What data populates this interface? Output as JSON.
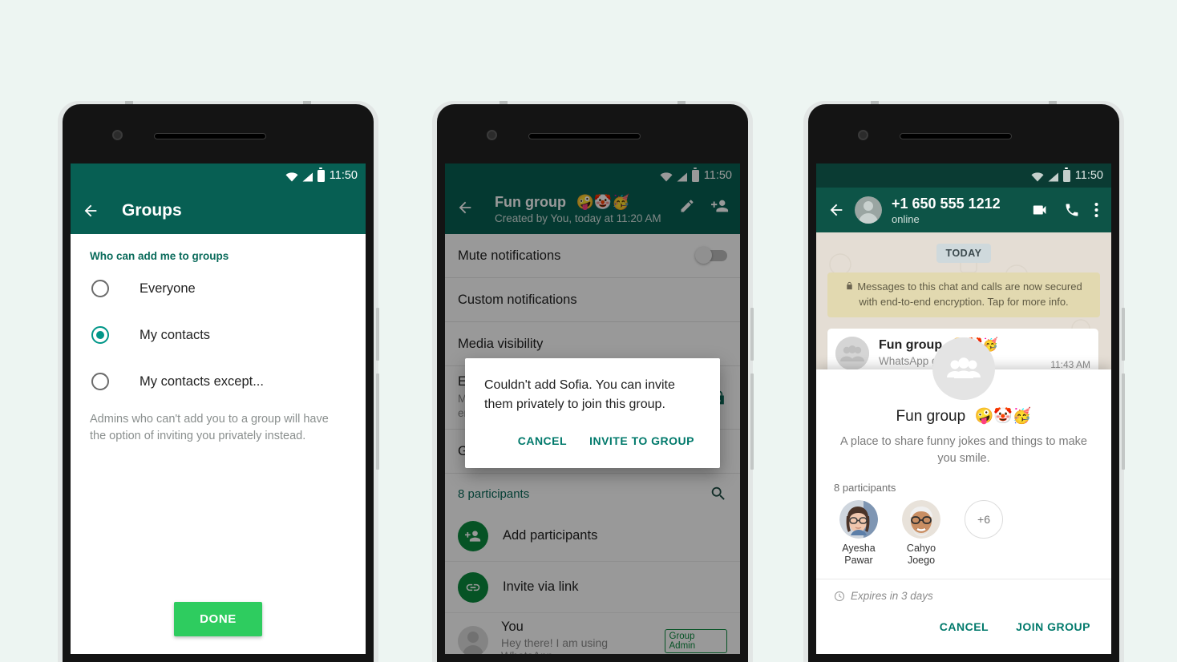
{
  "background_color": "#edf5f2",
  "theme": {
    "teal_dark": "#075f53",
    "teal_accent": "#00796b",
    "green_button": "#2ecc5f",
    "green_circle": "#0a8a3f",
    "radio_selected": "#009688"
  },
  "phone1": {
    "status_bar": {
      "time": "11:50",
      "icons": [
        "wifi-icon",
        "signal-icon",
        "battery-icon"
      ]
    },
    "appbar": {
      "back_icon": "back-arrow-icon",
      "title": "Groups"
    },
    "section_header": "Who can add me to groups",
    "options": [
      {
        "label": "Everyone",
        "selected": false
      },
      {
        "label": "My contacts",
        "selected": true
      },
      {
        "label": "My contacts except...",
        "selected": false
      }
    ],
    "helper_text": "Admins who can't add you to a group will have the option of inviting you privately instead.",
    "done_label": "DONE"
  },
  "phone2": {
    "status_bar": {
      "time": "11:50"
    },
    "appbar": {
      "back_icon": "back-arrow-icon",
      "title": "Fun group",
      "title_emoji": "🤪🤡🥳",
      "subtitle": "Created by You, today at 11:20 AM",
      "edit_icon": "pencil-icon",
      "add_person_icon": "add-person-icon"
    },
    "rows": [
      {
        "label": "Mute notifications",
        "control": "toggle-off"
      },
      {
        "label": "Custom notifications"
      },
      {
        "label": "Media visibility"
      }
    ],
    "encryption_row": {
      "title": "Encryption",
      "subtitle": "Messages and calls are end-to-end encrypted. Tap to verify.",
      "icon": "lock-icon"
    },
    "group_row_partial": "Group settings",
    "participants": {
      "count_label": "8 participants",
      "search_icon": "search-icon",
      "actions": [
        {
          "label": "Add participants",
          "icon": "add-person-icon"
        },
        {
          "label": "Invite via link",
          "icon": "link-icon"
        }
      ],
      "people": [
        {
          "name": "You",
          "status": "Hey there! I am using WhatsApp.",
          "badge": "Group Admin"
        }
      ]
    },
    "dialog": {
      "message": "Couldn't add Sofia. You can invite them privately to join this group.",
      "cancel_label": "CANCEL",
      "confirm_label": "INVITE TO GROUP"
    }
  },
  "phone3": {
    "status_bar": {
      "time": "11:50"
    },
    "appbar": {
      "back_icon": "back-arrow-icon",
      "avatar": "contact-avatar",
      "title": "+1 650 555 1212",
      "subtitle": "online",
      "video_icon": "video-call-icon",
      "call_icon": "phone-call-icon",
      "menu_icon": "overflow-menu-icon"
    },
    "date_pill": "TODAY",
    "encryption_banner": "Messages to this chat and calls are now secured with end-to-end encryption. Tap for more info.",
    "group_bubble": {
      "title": "Fun group",
      "title_emoji": "🤪🤡🥳",
      "subtitle": "WhatsApp group",
      "time": "11:43 AM"
    },
    "invite_card": {
      "group_icon": "group-people-icon",
      "title": "Fun group",
      "title_emoji": "🤪🤡🥳",
      "description": "A place to share funny jokes and things to make you smile.",
      "participants_count": "8 participants",
      "participants": [
        {
          "name": "Ayesha Pawar",
          "avatar": "photo-avatar-1"
        },
        {
          "name": "Cahyo Joego",
          "avatar": "photo-avatar-2"
        },
        {
          "name": "+6",
          "avatar": "more-count"
        }
      ],
      "expiry_icon": "clock-icon",
      "expiry_text": "Expires in 3 days",
      "cancel_label": "CANCEL",
      "join_label": "JOIN GROUP"
    }
  }
}
